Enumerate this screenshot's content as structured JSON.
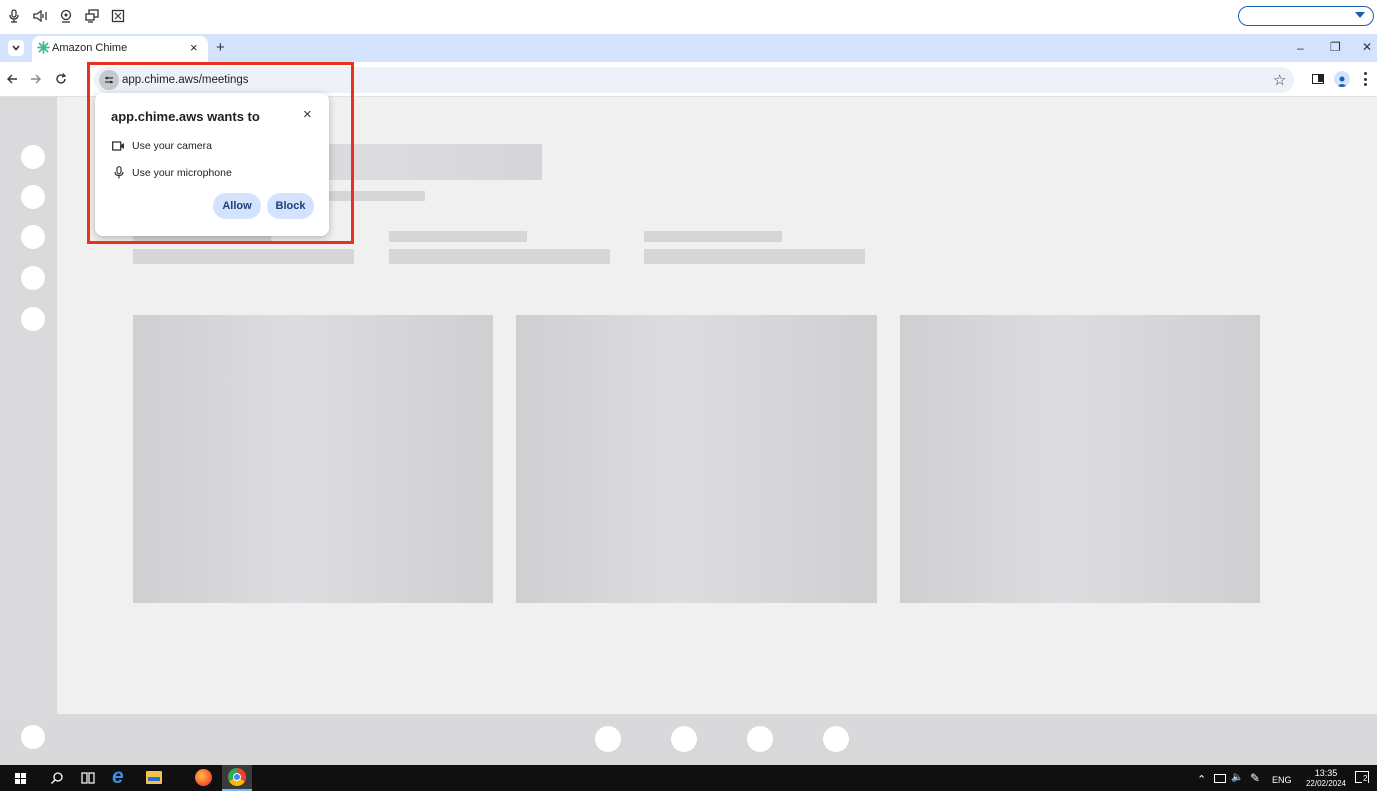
{
  "remote_toolbar": {
    "icons": [
      "microphone-icon",
      "speaker-icon",
      "webcam-icon",
      "multi-monitor-icon",
      "fullscreen-icon"
    ]
  },
  "browser": {
    "tab_title": "Amazon Chime",
    "new_tab": "+",
    "tab_close": "×",
    "url": "app.chime.aws/meetings",
    "window_controls": {
      "minimize": "–",
      "restore": "❐",
      "close": "✕"
    }
  },
  "permission_popup": {
    "title": "app.chime.aws wants to",
    "close": "×",
    "permissions": [
      "Use your camera",
      "Use your microphone"
    ],
    "allow_label": "Allow",
    "block_label": "Block"
  },
  "taskbar": {
    "language": "ENG",
    "time": "13:35",
    "date": "22/02/2024",
    "notification_count": "2"
  },
  "colors": {
    "highlight": "#e8321e",
    "tabstrip": "#d3e3fd",
    "button": "#d3e3fd"
  }
}
